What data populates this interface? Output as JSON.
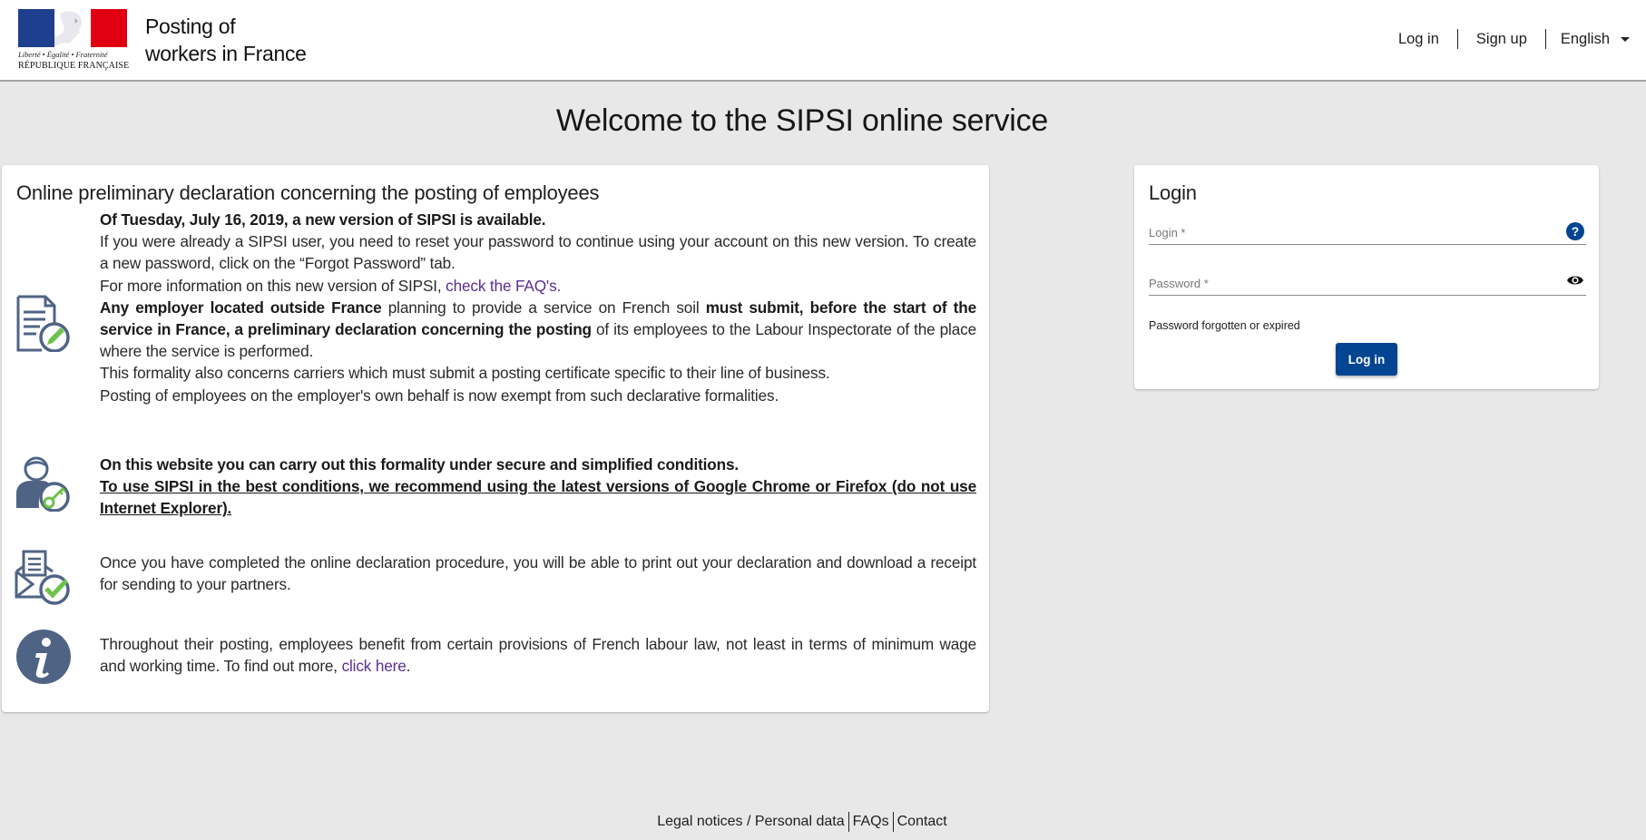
{
  "header": {
    "logo": {
      "motto": "Liberté • Égalité • Fraternité",
      "name": "RÉPUBLIQUE FRANÇAISE"
    },
    "site_title_line1": "Posting of",
    "site_title_line2": "workers in France",
    "nav": {
      "login": "Log in",
      "signup": "Sign up",
      "language": "English"
    }
  },
  "page_title": "Welcome to the SIPSI online service",
  "info_card": {
    "heading": "Online preliminary declaration concerning the posting of employees",
    "block1": {
      "icon": "document-edit-icon",
      "title": "Of Tuesday, July 16, 2019, a new version of SIPSI is available.",
      "p1": "If you were already a SIPSI user, you need to reset your password to continue using your account on this new version. To create a new password, click on the “Forgot Password” tab.",
      "p2_text": "For more information on this new version of SIPSI, ",
      "p2_link": "check the FAQ's.",
      "p3_bold1": "Any employer located outside France",
      "p3_text1": " planning to provide a service on French soil ",
      "p3_bold2": "must submit, before the start of the service in France, a preliminary declaration concerning the posting",
      "p3_text2": " of its employees to the Labour Inspectorate of the place where the service is performed.",
      "p4": "This formality also concerns carriers which must submit a posting certificate specific to their line of business.",
      "p5": "Posting of employees on the employer's own behalf is now exempt from such declarative formalities."
    },
    "block2": {
      "icon": "user-key-icon",
      "title": "On this website you can carry out this formality under secure and simplified conditions.",
      "recommendation": "To use SIPSI in the best conditions, we recommend using the latest versions of Google Chrome or Firefox (do not use Internet Explorer)."
    },
    "block3": {
      "icon": "envelope-check-icon",
      "text": "Once you have completed the online declaration procedure, you will be able to print out your declaration and download a receipt for sending to your partners."
    },
    "block4": {
      "icon": "info-icon",
      "text": "Throughout their posting, employees benefit from certain provisions of French labour law, not least in terms of minimum wage and working time. To find out more, ",
      "link": "click here",
      "end": "."
    }
  },
  "login_card": {
    "heading": "Login",
    "login_label": "Login *",
    "login_value": "",
    "password_label": "Password *",
    "password_value": "",
    "forgot_link": "Password forgotten or expired",
    "submit_label": "Log in"
  },
  "footer": {
    "legal": "Legal notices / Personal data",
    "faqs": "FAQs",
    "contact": "Contact"
  },
  "colors": {
    "background": "#e8e8e8",
    "primary_button": "#034590",
    "link": "#5c2e91",
    "icon_slate": "#4f6485",
    "icon_green": "#6cc24a",
    "help_icon": "#034590"
  }
}
